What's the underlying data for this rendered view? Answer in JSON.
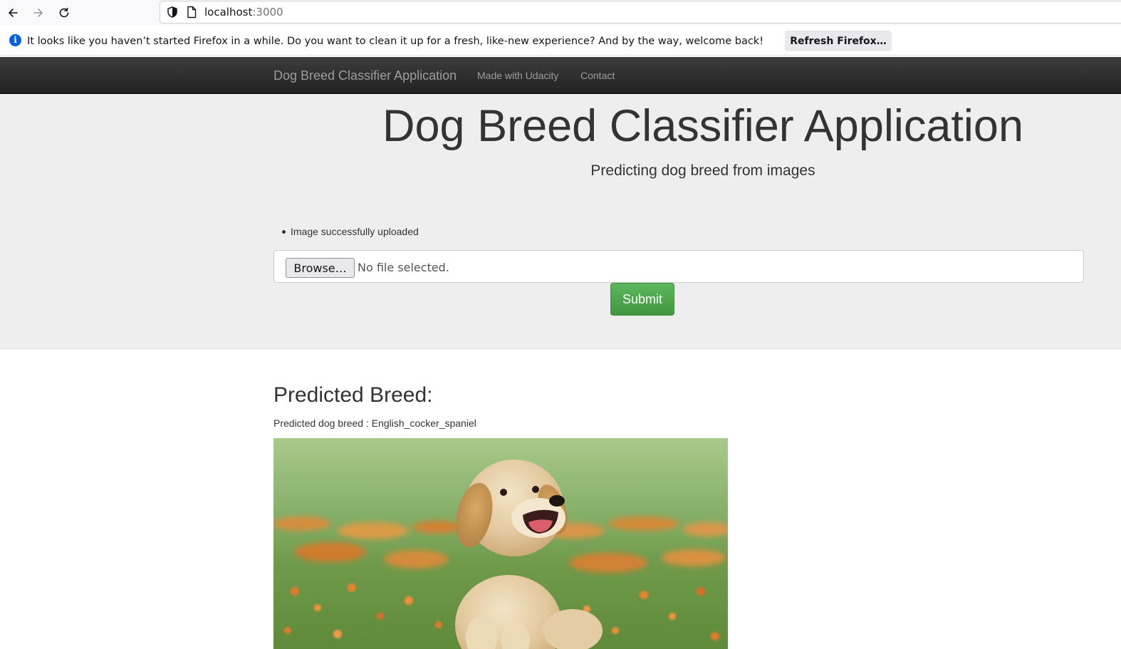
{
  "browser": {
    "url_host": "localhost",
    "url_port": ":3000"
  },
  "infobar": {
    "message": "It looks like you haven’t started Firefox in a while. Do you want to clean it up for a fresh, like-new experience? And by the way, welcome back!",
    "button_label": "Refresh Firefox…"
  },
  "navbar": {
    "brand": "Dog Breed Classifier Application",
    "links": [
      "Made with Udacity",
      "Contact"
    ]
  },
  "jumbotron": {
    "title": "Dog Breed Classifier Application",
    "subtitle": "Predicting dog breed from images",
    "flash_message": "Image successfully uploaded",
    "browse_label": "Browse…",
    "file_status": "No file selected.",
    "submit_label": "Submit"
  },
  "result": {
    "heading": "Predicted Breed:",
    "text": "Predicted dog breed : English_cocker_spaniel"
  },
  "colors": {
    "navbar": "#222222",
    "jumbotron": "#eeeeee",
    "submit": "#5cb85c"
  }
}
